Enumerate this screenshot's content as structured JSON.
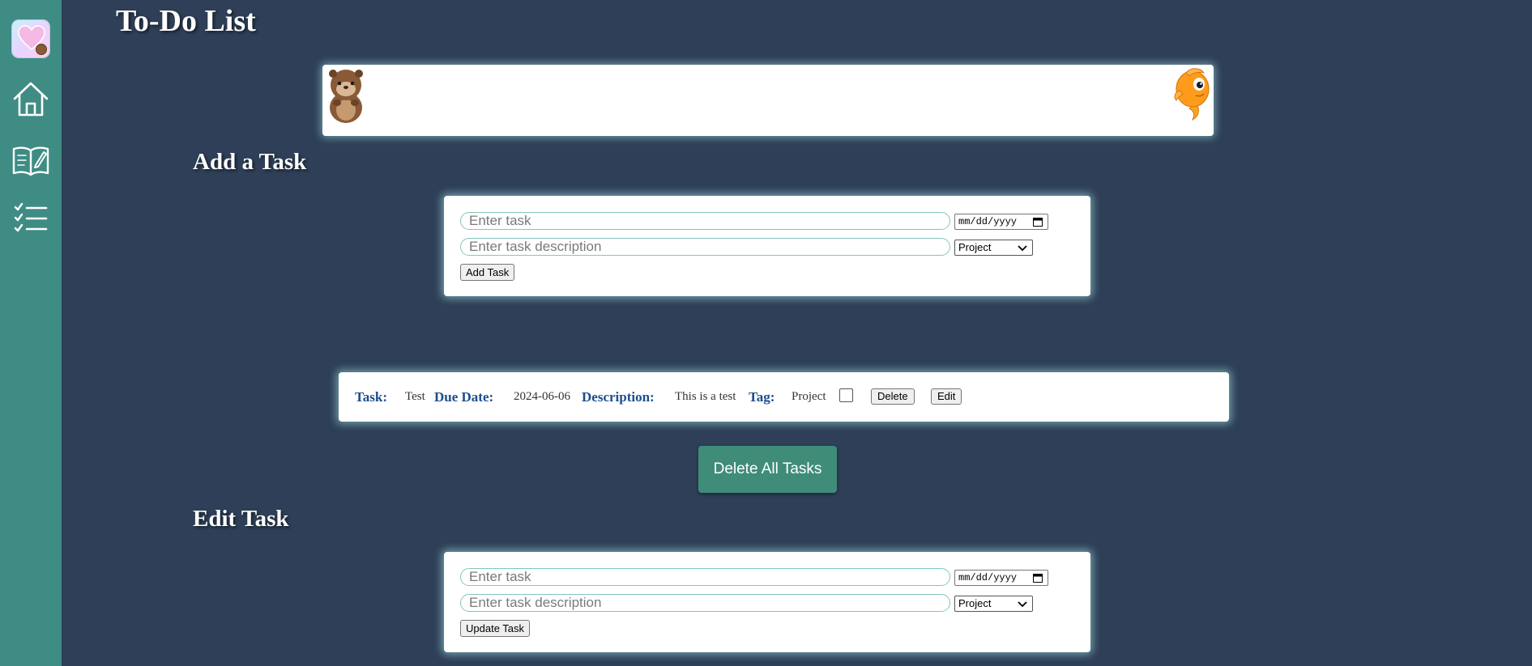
{
  "page": {
    "title": "To-Do List"
  },
  "sidebar": {
    "items": [
      {
        "icon": "home-icon"
      },
      {
        "icon": "journal-book-icon"
      },
      {
        "icon": "checklist-icon"
      }
    ]
  },
  "add_section": {
    "heading": "Add a Task",
    "task_placeholder": "Enter task",
    "task_value": "",
    "description_placeholder": "Enter task description",
    "description_value": "",
    "date_value": "mm/dd/yyyy",
    "tag_selected": "Project",
    "submit_label": "Add Task"
  },
  "tasks": [
    {
      "task_label": "Task:",
      "task": "Test",
      "due_label": "Due Date:",
      "due_date": "2024-06-06",
      "description_label": "Description:",
      "description": "This is a test",
      "tag_label": "Tag:",
      "tag": "Project",
      "completed": false,
      "delete_label": "Delete",
      "edit_label": "Edit"
    }
  ],
  "delete_all_label": "Delete All Tasks",
  "edit_section": {
    "heading": "Edit Task",
    "task_placeholder": "Enter task",
    "task_value": "",
    "description_placeholder": "Enter task description",
    "description_value": "",
    "date_value": "mm/dd/yyyy",
    "tag_selected": "Project",
    "submit_label": "Update Task"
  },
  "colors": {
    "background": "#2e3f57",
    "sidebar": "#3f8c84",
    "label_blue": "#1c4d8e",
    "button_green": "#3f8c79"
  }
}
